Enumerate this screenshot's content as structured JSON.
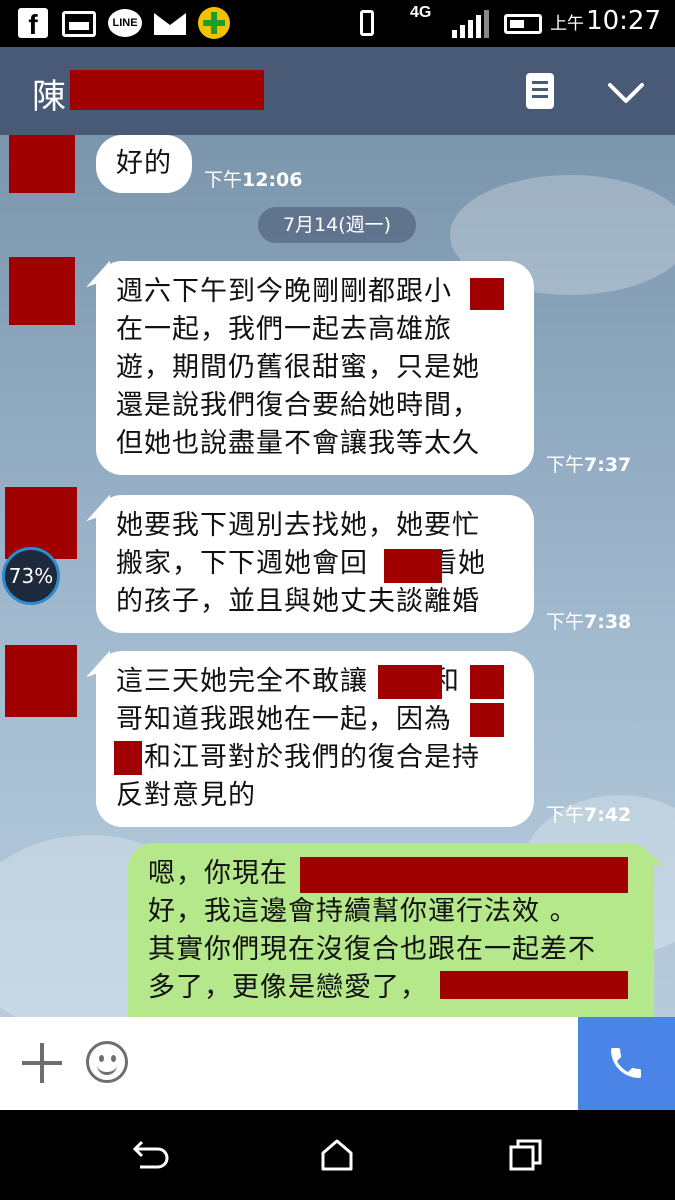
{
  "status_bar": {
    "app_icons": [
      "facebook-icon",
      "gallery-icon",
      "line-icon",
      "mail-icon",
      "plus-app-icon"
    ],
    "network": "4G",
    "clock_ampm": "上午",
    "clock_time": "10:27"
  },
  "header": {
    "title": "陳",
    "menu_icon": "memo-icon",
    "collapse_icon": "chevron-down-icon"
  },
  "chat": {
    "messages": [
      {
        "side": "left",
        "text": [
          "好的"
        ],
        "time_prefix": "下午",
        "time": "12:06"
      },
      {
        "side": "left",
        "text": [
          "週六下午到今晚剛剛都跟小",
          "在一起，我們一起去高雄旅",
          "遊，期間仍舊很甜蜜，只是她",
          "還是說我們復合要給她時間，",
          "但她也說盡量不會讓我等太久"
        ],
        "time_prefix": "下午",
        "time": "7:37"
      },
      {
        "side": "left",
        "text": [
          "她要我下週別去找她，她要忙",
          "搬家，下下週她會回",
          "看她",
          "的孩子，並且與她丈夫談離婚"
        ],
        "time_prefix": "下午",
        "time": "7:38"
      },
      {
        "side": "left",
        "text": [
          "這三天她完全不敢讓",
          "和",
          "哥知道我跟她在一起，因為",
          "和江哥對於我們的復合是持",
          "反對意見的"
        ],
        "time_prefix": "下午",
        "time": "7:42"
      },
      {
        "side": "right",
        "text": [
          "嗯，你現在",
          "好，我這邊會持續幫你運行法效 。",
          "其實你們現在沒復合也跟在一起差不",
          "多了，更像是戀愛了，"
        ]
      }
    ],
    "date_divider": "7月14(週一)",
    "battery_badge": "73%"
  },
  "input_bar": {
    "add_icon": "plus-icon",
    "emoji_icon": "emoji-icon",
    "call_icon": "phone-icon"
  },
  "nav_bar": {
    "back_icon": "back-icon",
    "home_icon": "home-icon",
    "recents_icon": "recents-icon"
  },
  "colors": {
    "header": "#495a77",
    "green_bubble": "#b5e88a",
    "call_button": "#4a84e6",
    "redaction": "#a10000"
  }
}
